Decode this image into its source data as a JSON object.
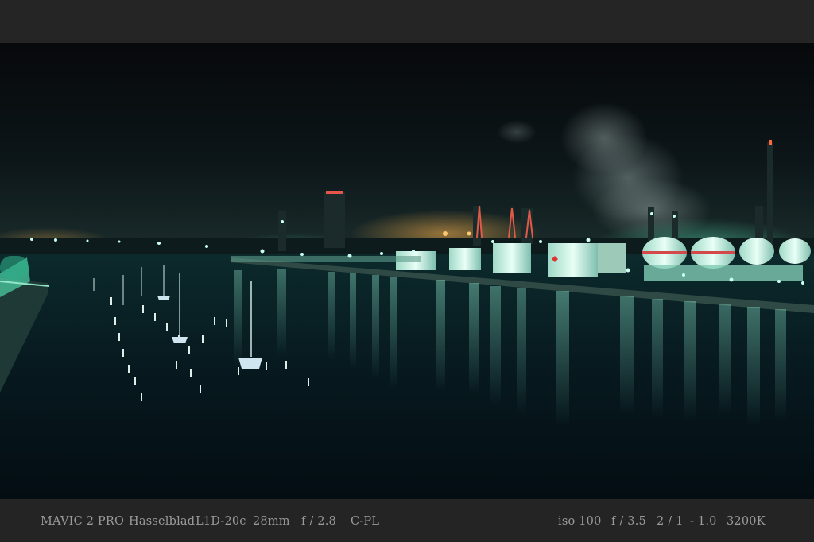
{
  "photo": {
    "scene": "night-harbor-industrial-complex",
    "accent_colors": {
      "sky": "#0b1518",
      "water": "#06141a",
      "lights": "#7fffd4",
      "warm": "#ffb24a"
    }
  },
  "exif_bar": {
    "left": {
      "camera": "MAVIC 2 PRO",
      "brand": "Hasselblad",
      "sensor": "L1D-20c",
      "focal_length": "28mm",
      "aperture": "f / 2.8",
      "filter": "C-PL"
    },
    "right": {
      "iso": "iso 100",
      "aperture": "f / 3.5",
      "shutter": "2 / 1",
      "exposure_comp": "- 1.0",
      "white_balance": "3200K"
    }
  }
}
